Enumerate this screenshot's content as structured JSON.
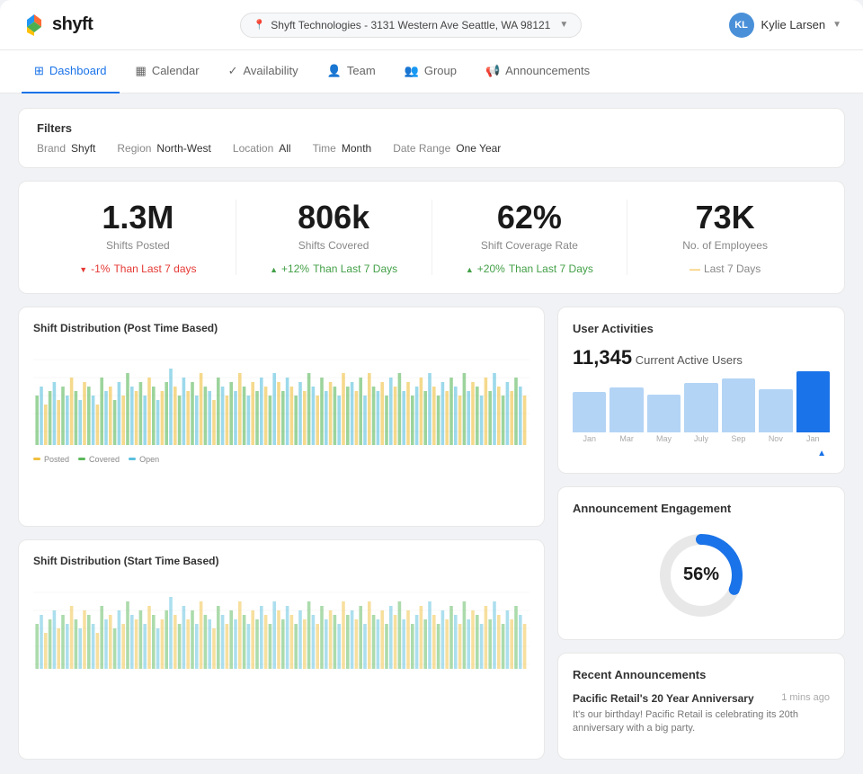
{
  "header": {
    "logo_text": "shyft",
    "location": "Shyft Technologies - 3131 Western Ave Seattle, WA 98121",
    "user_name": "Kylie Larsen",
    "user_initials": "KL"
  },
  "nav": {
    "items": [
      {
        "id": "dashboard",
        "label": "Dashboard",
        "active": true,
        "icon": "⊞"
      },
      {
        "id": "calendar",
        "label": "Calendar",
        "active": false,
        "icon": "📅"
      },
      {
        "id": "availability",
        "label": "Availability",
        "active": false,
        "icon": "✓"
      },
      {
        "id": "team",
        "label": "Team",
        "active": false,
        "icon": "👤"
      },
      {
        "id": "group",
        "label": "Group",
        "active": false,
        "icon": "👥"
      },
      {
        "id": "announcements",
        "label": "Announcements",
        "active": false,
        "icon": "📢"
      }
    ]
  },
  "filters": {
    "title": "Filters",
    "items": [
      {
        "label": "Brand",
        "value": "Shyft"
      },
      {
        "label": "Region",
        "value": "North-West"
      },
      {
        "label": "Location",
        "value": "All"
      },
      {
        "label": "Time",
        "value": "Month"
      },
      {
        "label": "Date Range",
        "value": "One Year"
      }
    ]
  },
  "stats": [
    {
      "value": "1.3M",
      "label": "Shifts Posted",
      "change": "-1%",
      "change_suffix": "Than Last 7 days",
      "direction": "negative"
    },
    {
      "value": "806k",
      "label": "Shifts Covered",
      "change": "+12%",
      "change_suffix": "Than Last 7 Days",
      "direction": "positive"
    },
    {
      "value": "62%",
      "label": "Shift Coverage Rate",
      "change": "+20%",
      "change_suffix": "Than Last 7 Days",
      "direction": "positive"
    },
    {
      "value": "73K",
      "label": "No. of Employees",
      "change": "",
      "change_suffix": "Last 7 Days",
      "direction": "neutral"
    }
  ],
  "charts": {
    "shift_distribution_post": {
      "title": "Shift Distribution (Post Time Based)",
      "legend": [
        {
          "color": "#f0c040",
          "label": "Posted"
        },
        {
          "color": "#5cb85c",
          "label": "Covered"
        },
        {
          "color": "#5bc0de",
          "label": "Open"
        }
      ]
    },
    "shift_distribution_start": {
      "title": "Shift Distribution (Start Time Based)"
    }
  },
  "user_activities": {
    "title": "User Activities",
    "active_count": "11,345",
    "active_label": "Current Active Users",
    "bars": [
      {
        "label": "Jan",
        "height": 45,
        "highlight": false
      },
      {
        "label": "Mar",
        "height": 50,
        "highlight": false
      },
      {
        "label": "May",
        "height": 42,
        "highlight": false
      },
      {
        "label": "July",
        "height": 55,
        "highlight": false
      },
      {
        "label": "Sep",
        "height": 60,
        "highlight": false
      },
      {
        "label": "Nov",
        "height": 48,
        "highlight": false
      },
      {
        "label": "Jan",
        "height": 68,
        "highlight": true
      }
    ]
  },
  "announcement_engagement": {
    "title": "Announcement Engagement",
    "percentage": 56,
    "label": "56%"
  },
  "recent_announcements": {
    "title": "Recent Announcements",
    "items": [
      {
        "title": "Pacific Retail's 20 Year Anniversary",
        "time": "1 mins ago",
        "body": "It's our birthday! Pacific Retail is celebrating its 20th anniversary with a big party."
      }
    ]
  }
}
